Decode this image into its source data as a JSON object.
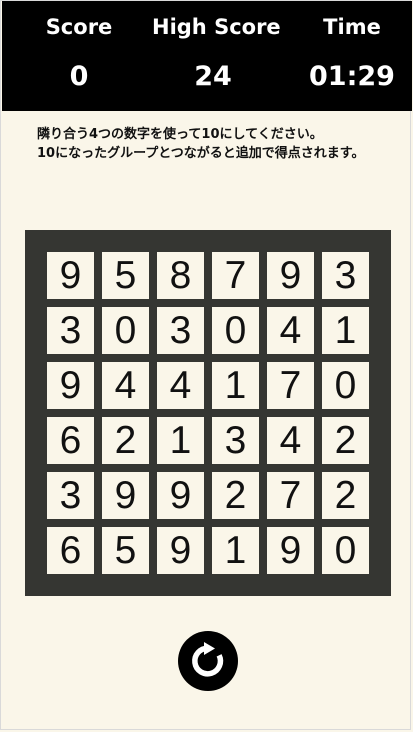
{
  "header": {
    "score_label": "Score",
    "score_value": "0",
    "high_score_label": "High Score",
    "high_score_value": "24",
    "time_label": "Time",
    "time_value": "01:29"
  },
  "instructions": {
    "line1": "隣り合う4つの数字を使って10にしてください。",
    "line2": "10になったグループとつながると追加で得点されます。"
  },
  "board": {
    "rows": [
      [
        "9",
        "5",
        "8",
        "7",
        "9",
        "3"
      ],
      [
        "3",
        "0",
        "3",
        "0",
        "4",
        "1"
      ],
      [
        "9",
        "4",
        "4",
        "1",
        "7",
        "0"
      ],
      [
        "6",
        "2",
        "1",
        "3",
        "4",
        "2"
      ],
      [
        "3",
        "9",
        "9",
        "2",
        "7",
        "2"
      ],
      [
        "6",
        "5",
        "9",
        "1",
        "9",
        "0"
      ]
    ]
  },
  "icons": {
    "reset": "reset-icon"
  },
  "colors": {
    "header_bg": "#000000",
    "page_bg": "#faf6e9",
    "board_bg": "#353632",
    "cell_bg": "#faf6e9",
    "text": "#111111"
  }
}
